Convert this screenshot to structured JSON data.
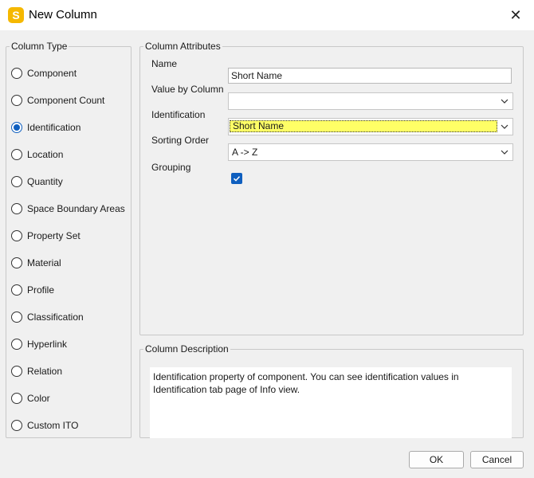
{
  "window": {
    "title": "New Column",
    "app_icon_letter": "S",
    "close_glyph": "✕"
  },
  "column_type": {
    "legend": "Column Type",
    "options": [
      {
        "label": "Component",
        "checked": false
      },
      {
        "label": "Component Count",
        "checked": false
      },
      {
        "label": "Identification",
        "checked": true
      },
      {
        "label": "Location",
        "checked": false
      },
      {
        "label": "Quantity",
        "checked": false
      },
      {
        "label": "Space Boundary Areas",
        "checked": false
      },
      {
        "label": "Property Set",
        "checked": false
      },
      {
        "label": "Material",
        "checked": false
      },
      {
        "label": "Profile",
        "checked": false
      },
      {
        "label": "Classification",
        "checked": false
      },
      {
        "label": "Hyperlink",
        "checked": false
      },
      {
        "label": "Relation",
        "checked": false
      },
      {
        "label": "Color",
        "checked": false
      },
      {
        "label": "Custom ITO",
        "checked": false
      }
    ]
  },
  "attributes": {
    "legend": "Column Attributes",
    "name_label": "Name",
    "name_value": "Short Name",
    "value_by_column_label": "Value by Column",
    "value_by_column_value": "",
    "identification_label": "Identification",
    "identification_value": "Short Name",
    "sorting_order_label": "Sorting Order",
    "sorting_order_value": "A -> Z",
    "grouping_label": "Grouping",
    "grouping_checked": true
  },
  "description": {
    "legend": "Column Description",
    "text": "Identification property of component. You can see identification values in Identification tab page of Info view."
  },
  "buttons": {
    "ok": "OK",
    "cancel": "Cancel"
  },
  "colors": {
    "accent": "#0f5fbf",
    "highlight": "#ffff66",
    "app_icon": "#f5b800"
  }
}
